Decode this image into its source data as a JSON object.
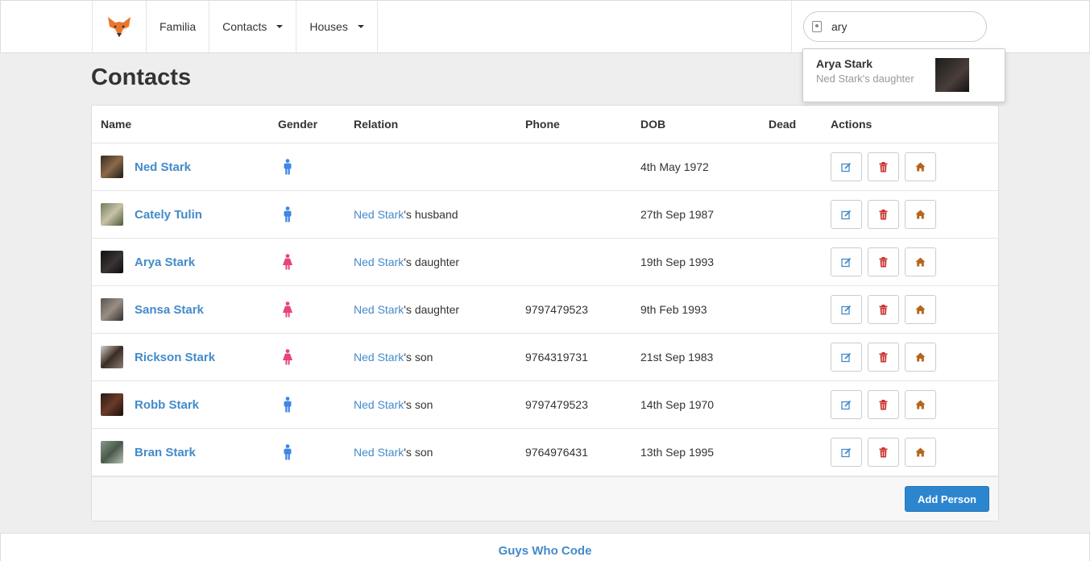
{
  "nav": {
    "brand": "Familia",
    "contacts": "Contacts",
    "houses": "Houses",
    "search_value": "ary"
  },
  "suggestion": {
    "name": "Arya Stark",
    "sub": "Ned Stark's daughter"
  },
  "page_title": "Contacts",
  "columns": {
    "name": "Name",
    "gender": "Gender",
    "relation": "Relation",
    "phone": "Phone",
    "dob": "DOB",
    "dead": "Dead",
    "actions": "Actions"
  },
  "rows": [
    {
      "name": "Ned Stark",
      "gender": "male",
      "relation_link": "",
      "relation_suffix": "",
      "phone": "",
      "dob": "4th May 1972",
      "dead": ""
    },
    {
      "name": "Cately Tulin",
      "gender": "male",
      "relation_link": "Ned Stark",
      "relation_suffix": "'s husband",
      "phone": "",
      "dob": "27th Sep 1987",
      "dead": ""
    },
    {
      "name": "Arya Stark",
      "gender": "female",
      "relation_link": "Ned Stark",
      "relation_suffix": "'s daughter",
      "phone": "",
      "dob": "19th Sep 1993",
      "dead": ""
    },
    {
      "name": "Sansa Stark",
      "gender": "female",
      "relation_link": "Ned Stark",
      "relation_suffix": "'s daughter",
      "phone": "9797479523",
      "dob": "9th Feb 1993",
      "dead": ""
    },
    {
      "name": "Rickson Stark",
      "gender": "female",
      "relation_link": "Ned Stark",
      "relation_suffix": "'s son",
      "phone": "9764319731",
      "dob": "21st Sep 1983",
      "dead": ""
    },
    {
      "name": "Robb Stark",
      "gender": "male",
      "relation_link": "Ned Stark",
      "relation_suffix": "'s son",
      "phone": "9797479523",
      "dob": "14th Sep 1970",
      "dead": ""
    },
    {
      "name": "Bran Stark",
      "gender": "male",
      "relation_link": "Ned Stark",
      "relation_suffix": "'s son",
      "phone": "9764976431",
      "dob": "13th Sep 1995",
      "dead": ""
    }
  ],
  "add_person": "Add Person",
  "footer": "Guys Who Code",
  "colors": {
    "link": "#428bca",
    "male": "#3f86e6",
    "female": "#e8437b",
    "delete": "#c9302c",
    "home": "#b5651d",
    "edit": "#428bca"
  },
  "icons": {
    "logo": "fox-logo-icon",
    "edit": "edit-icon",
    "delete": "trash-icon",
    "home": "home-icon",
    "male": "male-icon",
    "female": "female-icon"
  }
}
